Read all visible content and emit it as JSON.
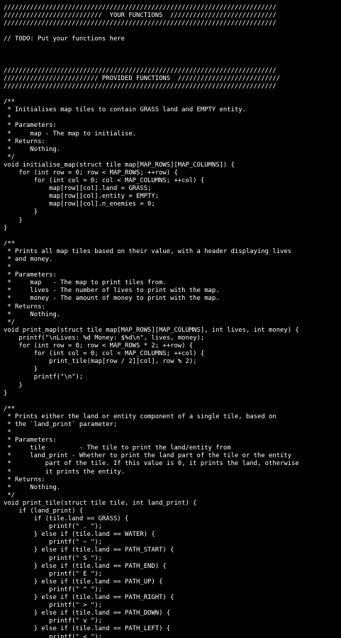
{
  "editor": {
    "lines": [
      "////////////////////////////////////////////////////////////////////////",
      "//////////////////////////  YOUR FUNCTIONS  ////////////////////////////",
      "////////////////////////////////////////////////////////////////////////",
      "",
      "// TODO: Put your functions here",
      "",
      "",
      "",
      "////////////////////////////////////////////////////////////////////////",
      "///////////////////////// PROVIDED FUNCTIONS  ///////////////////////////",
      "////////////////////////////////////////////////////////////////////////",
      "",
      "/**",
      " * Initialises map tiles to contain GRASS land and EMPTY entity.",
      " *",
      " * Parameters:",
      " *     map - The map to initialise.",
      " * Returns:",
      " *     Nothing.",
      " */",
      "void initialise_map(struct tile map[MAP_ROWS][MAP_COLUMNS]) {",
      "    for (int row = 0; row < MAP_ROWS; ++row) {",
      "        for (int col = 0; col < MAP_COLUMNS; ++col) {",
      "            map[row][col].land = GRASS;",
      "            map[row][col].entity = EMPTY;",
      "            map[row][col].n_enemies = 0;",
      "        }",
      "    }",
      "}",
      "",
      "/**",
      " * Prints all map tiles based on their value, with a header displaying lives",
      " * and money.",
      " *",
      " * Parameters:",
      " *     map   - The map to print tiles from.",
      " *     lives - The number of lives to print with the map.",
      " *     money - The amount of money to print with the map.",
      " * Returns:",
      " *     Nothing.",
      " */",
      "void print_map(struct tile map[MAP_ROWS][MAP_COLUMNS], int lives, int money) {",
      "    printf(\"\\nLives: %d Money: $%d\\n\", lives, money);",
      "    for (int row = 0; row < MAP_ROWS * 2; ++row) {",
      "        for (int col = 0; col < MAP_COLUMNS; ++col) {",
      "            print_tile(map[row / 2][col], row % 2);",
      "        }",
      "        printf(\"\\n\");",
      "    }",
      "}",
      "",
      "/**",
      " * Prints either the land or entity component of a single tile, based on",
      " * the `land_print` parameter;",
      " *",
      " * Parameters:",
      " *     tile         - The tile to print the land/entity from",
      " *     land_print - Whether to print the land part of the tile or the entity",
      " *         part of the tile. If this value is 0, it prints the land, otherwise",
      " *         it prints the entity.",
      " * Returns:",
      " *     Nothing.",
      " */",
      "void print_tile(struct tile tile, int land_print) {",
      "    if (land_print) {",
      "        if (tile.land == GRASS) {",
      "            printf(\" . \");",
      "        } else if (tile.land == WATER) {",
      "            printf(\" ~ \");",
      "        } else if (tile.land == PATH_START) {",
      "            printf(\" S \");",
      "        } else if (tile.land == PATH_END) {",
      "            printf(\" E \");",
      "        } else if (tile.land == PATH_UP) {",
      "            printf(\" ^ \");",
      "        } else if (tile.land == PATH_RIGHT) {",
      "            printf(\" > \");",
      "        } else if (tile.land == PATH_DOWN) {",
      "            printf(\" v \");",
      "        } else if (tile.land == PATH_LEFT) {",
      "            printf(\" < \");"
    ]
  },
  "colors": {
    "background": "#000000",
    "text": "#ffffff"
  }
}
